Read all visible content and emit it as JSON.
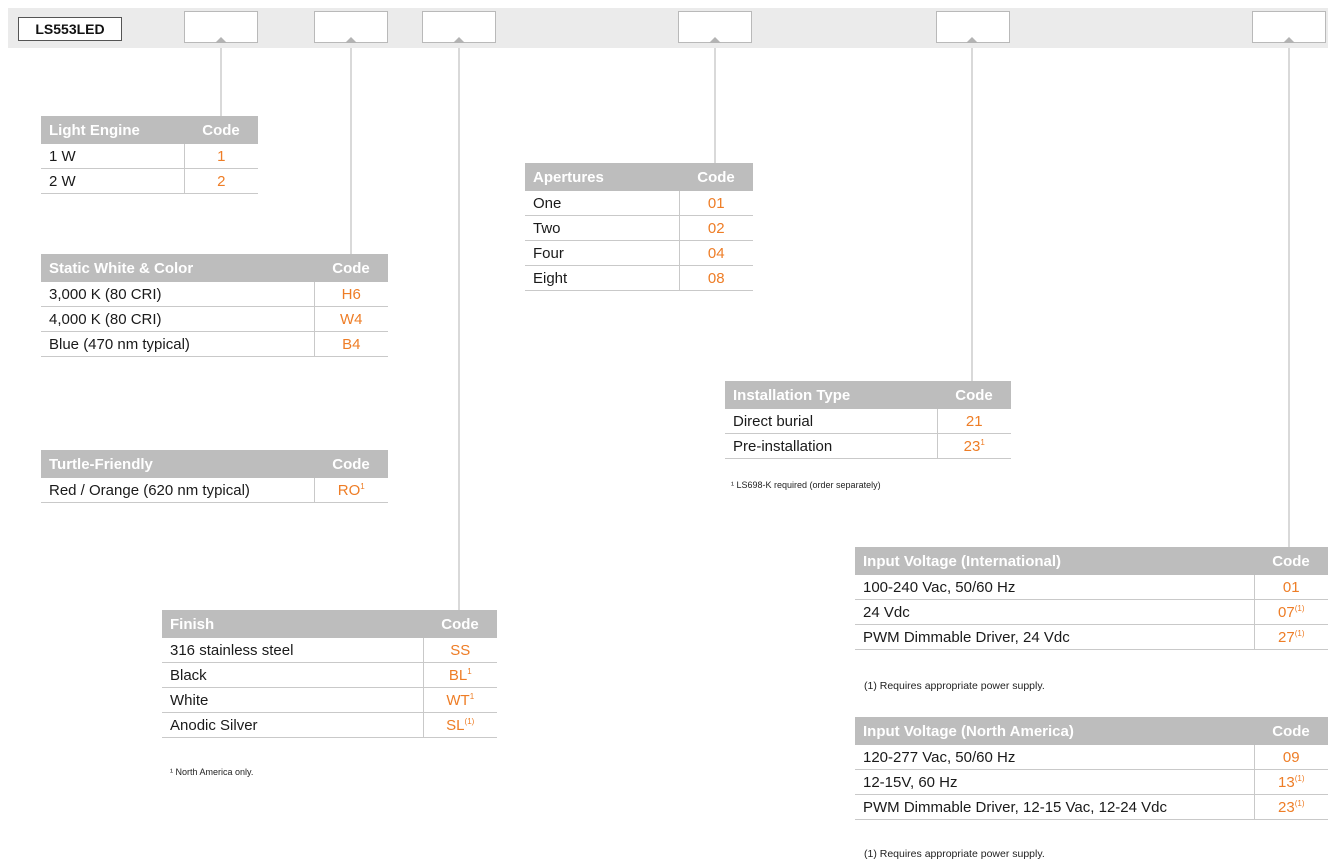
{
  "model": "LS553LED",
  "colors": {
    "code": "#ee7d26",
    "header": "#bdbdbd",
    "bar": "#ebebeb",
    "connector": "#b3b3b3"
  },
  "tables": {
    "light_engine": {
      "headers": [
        "Light Engine",
        "Code"
      ],
      "rows": [
        {
          "label": "1 W",
          "code": "1",
          "sup": ""
        },
        {
          "label": "2 W",
          "code": "2",
          "sup": ""
        }
      ]
    },
    "static_white": {
      "headers": [
        "Static White & Color",
        "Code"
      ],
      "rows": [
        {
          "label": "3,000 K (80 CRI)",
          "code": "H6",
          "sup": ""
        },
        {
          "label": "4,000 K (80 CRI)",
          "code": "W4",
          "sup": ""
        },
        {
          "label": "Blue (470 nm typical)",
          "code": "B4",
          "sup": ""
        }
      ]
    },
    "turtle": {
      "headers": [
        "Turtle-Friendly",
        "Code"
      ],
      "rows": [
        {
          "label": "Red / Orange (620 nm typical)",
          "code": "RO",
          "sup": "1"
        }
      ]
    },
    "finish": {
      "headers": [
        "Finish",
        "Code"
      ],
      "rows": [
        {
          "label": "316 stainless steel",
          "code": "SS",
          "sup": ""
        },
        {
          "label": "Black",
          "code": "BL",
          "sup": "1"
        },
        {
          "label": "White",
          "code": "WT",
          "sup": "1"
        },
        {
          "label": "Anodic Silver",
          "code": "SL",
          "sup": "(1)"
        }
      ],
      "note": "¹ North America only."
    },
    "apertures": {
      "headers": [
        "Apertures",
        "Code"
      ],
      "rows": [
        {
          "label": "One",
          "code": "01",
          "sup": ""
        },
        {
          "label": "Two",
          "code": "02",
          "sup": ""
        },
        {
          "label": "Four",
          "code": "04",
          "sup": ""
        },
        {
          "label": "Eight",
          "code": "08",
          "sup": ""
        }
      ]
    },
    "installation": {
      "headers": [
        "Installation Type",
        "Code"
      ],
      "rows": [
        {
          "label": "Direct burial",
          "code": "21",
          "sup": ""
        },
        {
          "label": "Pre-installation",
          "code": "23",
          "sup": "1"
        }
      ],
      "note": "¹ LS698-K required (order separately)"
    },
    "voltage_intl": {
      "headers": [
        "Input Voltage (International)",
        "Code"
      ],
      "rows": [
        {
          "label": "100-240 Vac, 50/60  Hz",
          "code": "01",
          "sup": ""
        },
        {
          "label": "24 Vdc",
          "code": "07",
          "sup": "(1)"
        },
        {
          "label": "PWM Dimmable Driver, 24 Vdc",
          "code": "27",
          "sup": "(1)"
        }
      ],
      "note": "(1)   Requires appropriate power supply."
    },
    "voltage_na": {
      "headers": [
        "Input Voltage (North America)",
        "Code"
      ],
      "rows": [
        {
          "label": "120-277 Vac, 50/60  Hz",
          "code": "09",
          "sup": ""
        },
        {
          "label": "12-15V, 60  Hz",
          "code": "13",
          "sup": "(1)"
        },
        {
          "label": "PWM Dimmable Driver, 12-15 Vac, 12-24 Vdc",
          "code": "23",
          "sup": "(1)"
        }
      ],
      "note": "(1)   Requires appropriate power supply."
    }
  }
}
